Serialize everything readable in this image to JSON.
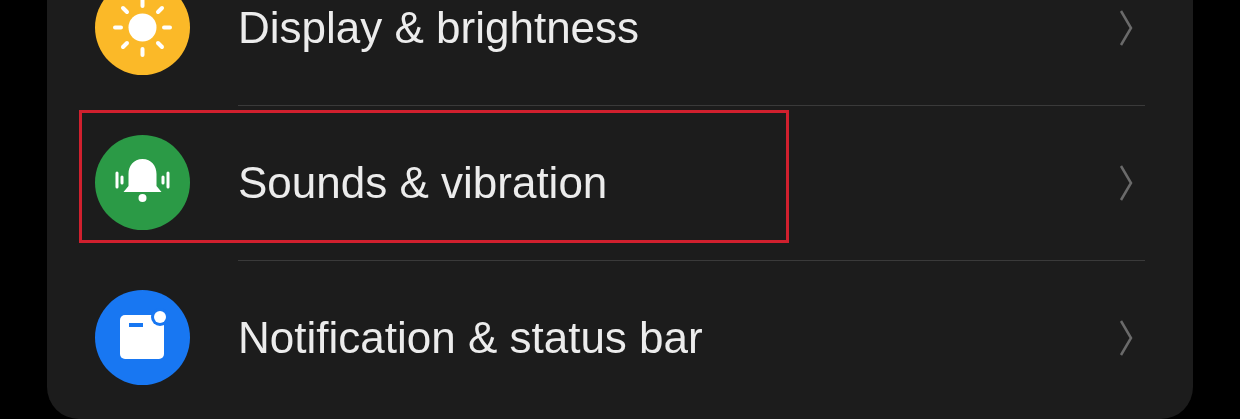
{
  "settings_items": [
    {
      "label": "Display & brightness",
      "kind": "display",
      "highlighted": false
    },
    {
      "label": "Sounds & vibration",
      "kind": "sound",
      "highlighted": true
    },
    {
      "label": "Notification & status bar",
      "kind": "notification",
      "highlighted": false
    }
  ]
}
